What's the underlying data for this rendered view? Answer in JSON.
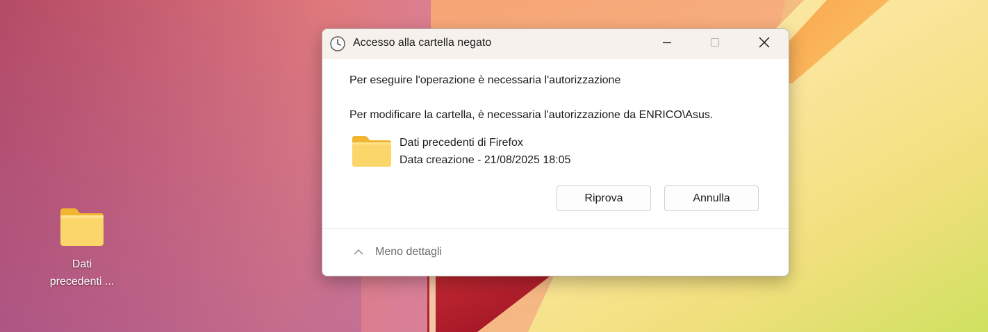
{
  "desktop": {
    "icon": {
      "name": "folder-icon",
      "label_line1": "Dati",
      "label_line2": "precedenti ..."
    }
  },
  "dialog": {
    "title": "Accesso alla cartella negato",
    "title_icon": "clock-icon",
    "controls": {
      "minimize": "minimize-icon",
      "maximize": "maximize-icon",
      "close": "close-icon"
    },
    "heading": "Per eseguire l'operazione è necessaria l'autorizzazione",
    "message": "Per modificare la cartella, è necessaria l'autorizzazione da ENRICO\\Asus.",
    "file": {
      "icon": "folder-icon",
      "name": "Dati precedenti di Firefox",
      "created": "Data creazione - 21/08/2025 18:05"
    },
    "buttons": {
      "retry": "Riprova",
      "cancel": "Annulla"
    },
    "footer": {
      "toggle_icon": "chevron-up-icon",
      "toggle_label": "Meno dettagli"
    }
  },
  "colors": {
    "titlebar": "#f6f1ec",
    "folder_light": "#fbd66b",
    "folder_dark": "#f2b531"
  }
}
